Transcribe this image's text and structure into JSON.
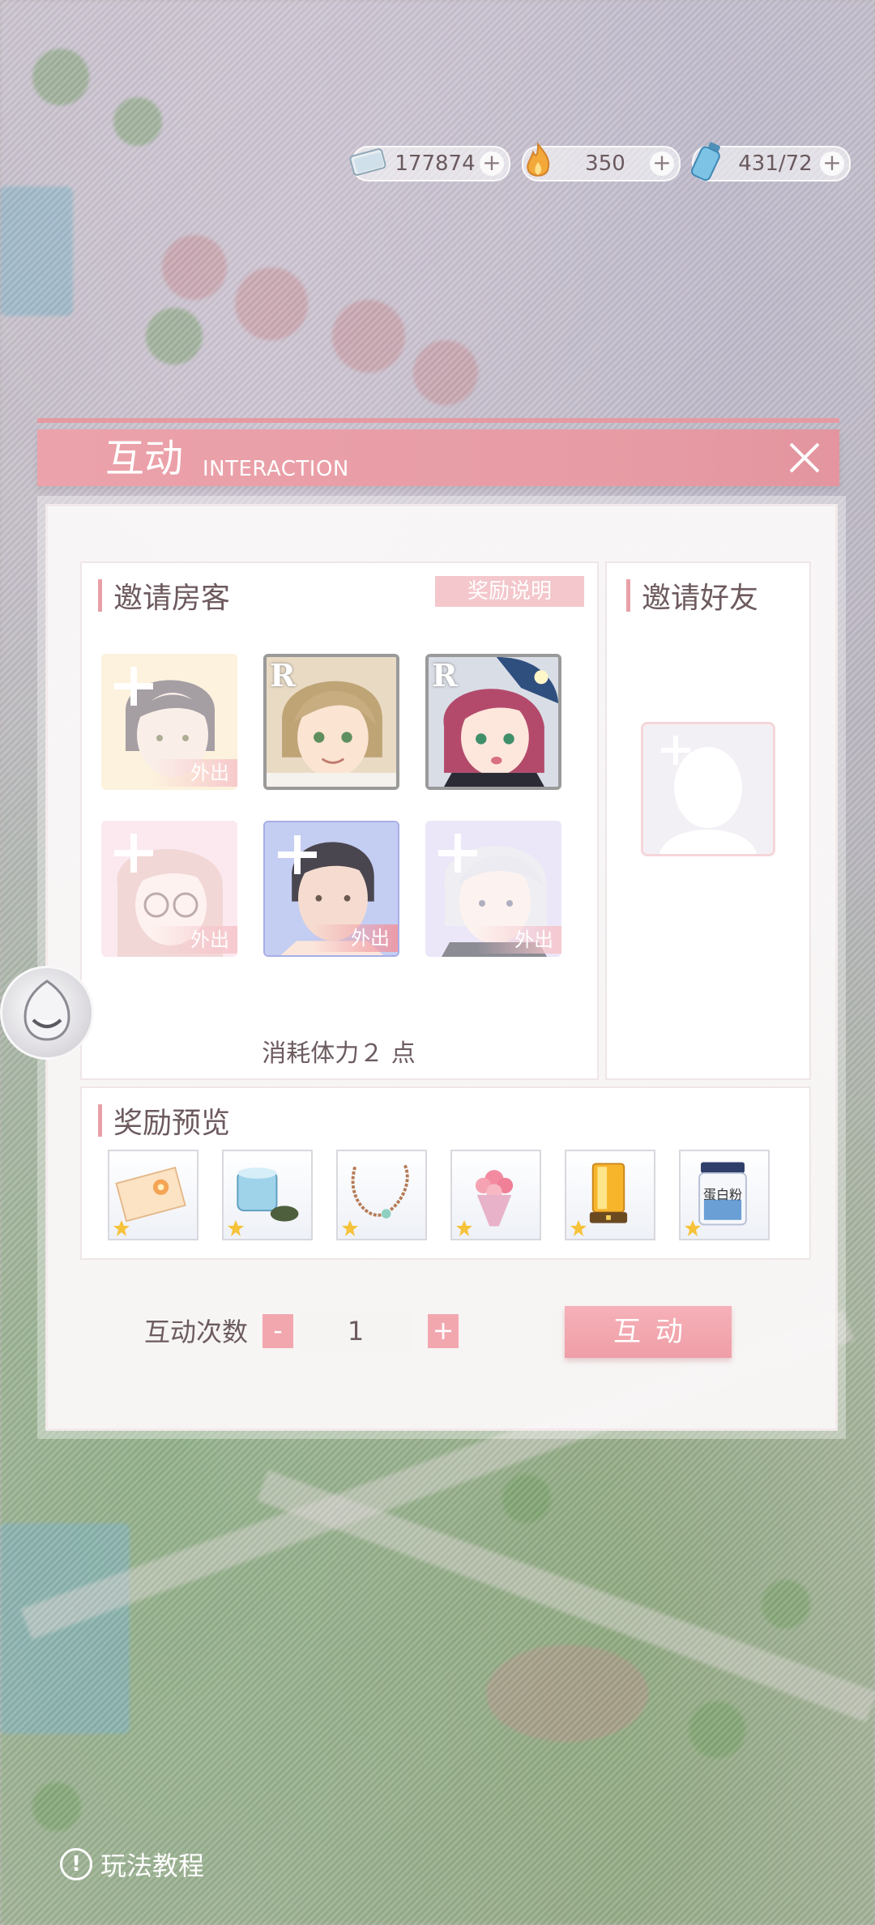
{
  "currency": {
    "coins": "177874",
    "flames": "350",
    "stamina": "431/72"
  },
  "dialog": {
    "title": "互动",
    "subtitle": "INTERACTION"
  },
  "invite_guests": {
    "title": "邀请房客",
    "reward_info_button": "奖励说明",
    "status_out": "外出",
    "rank": "R",
    "slots": [
      {
        "state": "out",
        "bg": "#fbe9c3"
      },
      {
        "state": "available",
        "rank": "R",
        "bg": "#e9dac4"
      },
      {
        "state": "available",
        "rank": "R",
        "bg": "#d9dde6"
      },
      {
        "state": "out",
        "bg": "#f8d8e3"
      },
      {
        "state": "out",
        "bg": "#c4cdf2"
      },
      {
        "state": "out",
        "bg": "#dcd3f4"
      }
    ],
    "cost_text": "消耗体力２ 点"
  },
  "invite_friends": {
    "title": "邀请好友"
  },
  "reward_preview": {
    "title": "奖励预览",
    "items": [
      {
        "name": "postcard-icon"
      },
      {
        "name": "cloth-roll-icon"
      },
      {
        "name": "necklace-icon"
      },
      {
        "name": "bouquet-icon"
      },
      {
        "name": "lamp-icon"
      },
      {
        "name": "protein-powder-icon",
        "label": "蛋白粉"
      }
    ]
  },
  "controls": {
    "count_label": "互动次数",
    "minus": "-",
    "plus": "+",
    "count_value": "1",
    "action_button": "互动"
  },
  "tutorial": {
    "label": "玩法教程",
    "icon": "!"
  },
  "colors": {
    "accent": "#ec9ea7",
    "text": "#6c5b5f"
  }
}
